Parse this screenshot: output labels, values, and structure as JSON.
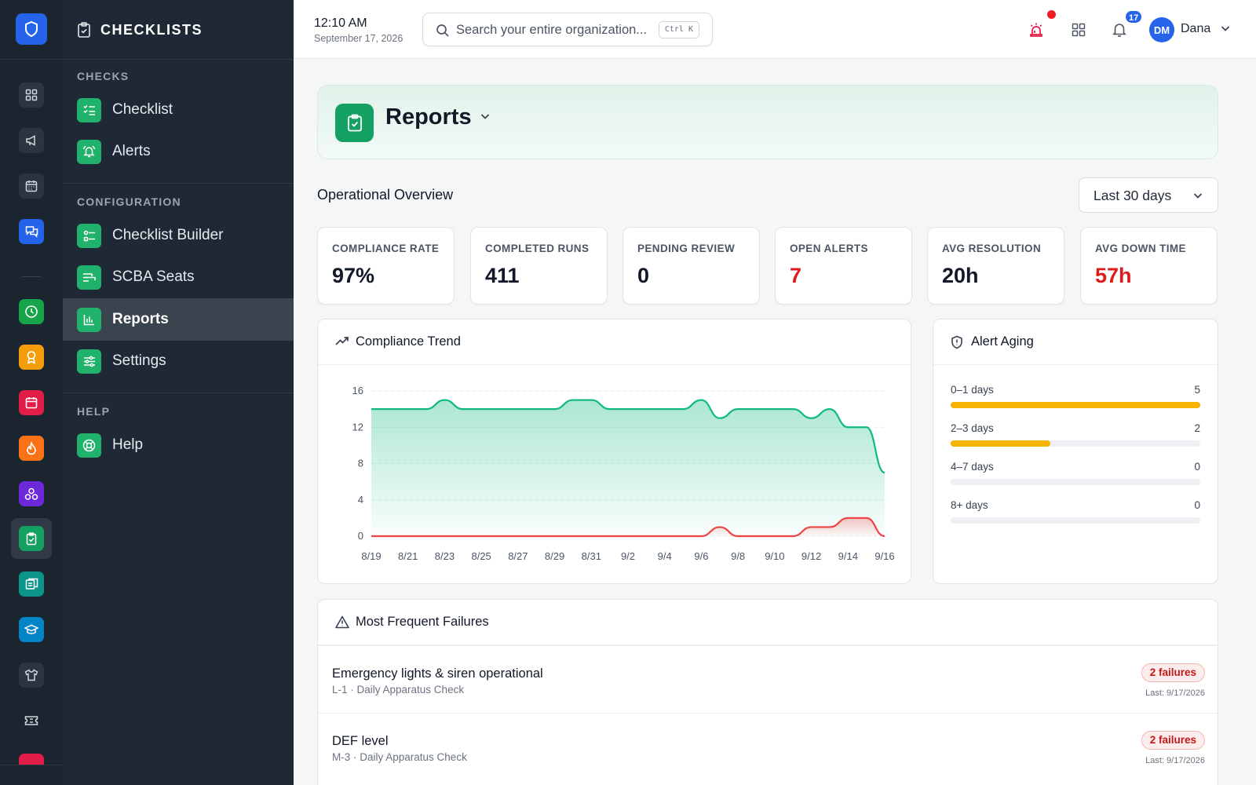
{
  "app": {
    "section_title": "CHECKLISTS"
  },
  "sidebar": {
    "sections": [
      {
        "label": "CHECKS",
        "items": [
          {
            "label": "Checklist",
            "icon": "list-check-icon"
          },
          {
            "label": "Alerts",
            "icon": "bell-ring-icon"
          }
        ]
      },
      {
        "label": "CONFIGURATION",
        "items": [
          {
            "label": "Checklist Builder",
            "icon": "builder-icon"
          },
          {
            "label": "SCBA Seats",
            "icon": "seats-icon"
          },
          {
            "label": "Reports",
            "icon": "bar-chart-icon",
            "active": true
          },
          {
            "label": "Settings",
            "icon": "sliders-icon"
          }
        ]
      },
      {
        "label": "HELP",
        "items": [
          {
            "label": "Help",
            "icon": "lifebuoy-icon"
          }
        ]
      }
    ]
  },
  "rail": {
    "colors": {
      "logo": "#2563eb",
      "clock": "#16a34a",
      "award": "#f59e0b",
      "calendar": "#e11d48",
      "fire": "#f97316",
      "network": "#6d28d9",
      "checklist": "#14a063",
      "docs": "#0d9488",
      "training": "#0284c7"
    }
  },
  "topbar": {
    "time": "12:10 AM",
    "date": "September 17, 2026",
    "search_placeholder": "Search your entire organization...",
    "search_shortcut": "Ctrl K",
    "notification_count": "17",
    "user_initials": "DM",
    "user_name": "Dana"
  },
  "page": {
    "title": "Reports",
    "overview_title": "Operational Overview",
    "range_label": "Last 30 days",
    "accent": "#14a063"
  },
  "stats": [
    {
      "label": "COMPLIANCE RATE",
      "value": "97%",
      "alert": false
    },
    {
      "label": "COMPLETED RUNS",
      "value": "411",
      "alert": false
    },
    {
      "label": "PENDING REVIEW",
      "value": "0",
      "alert": false
    },
    {
      "label": "OPEN ALERTS",
      "value": "7",
      "alert": true
    },
    {
      "label": "AVG RESOLUTION",
      "value": "20h",
      "alert": false
    },
    {
      "label": "AVG DOWN TIME",
      "value": "57h",
      "alert": true
    }
  ],
  "trend_card": {
    "title": "Compliance Trend"
  },
  "chart_data": {
    "type": "area",
    "title": "Compliance Trend",
    "xlabel": "",
    "ylabel": "",
    "ylim": [
      0,
      16
    ],
    "yticks": [
      0,
      4,
      8,
      12,
      16
    ],
    "grid": true,
    "x": [
      "8/19",
      "8/20",
      "8/21",
      "8/22",
      "8/23",
      "8/24",
      "8/25",
      "8/26",
      "8/27",
      "8/28",
      "8/29",
      "8/30",
      "8/31",
      "9/1",
      "9/2",
      "9/3",
      "9/4",
      "9/5",
      "9/6",
      "9/7",
      "9/8",
      "9/9",
      "9/10",
      "9/11",
      "9/12",
      "9/13",
      "9/14",
      "9/15",
      "9/16"
    ],
    "xtick_labels": [
      "8/19",
      "8/21",
      "8/23",
      "8/25",
      "8/27",
      "8/29",
      "8/31",
      "9/2",
      "9/4",
      "9/6",
      "9/8",
      "9/10",
      "9/12",
      "9/14",
      "9/16"
    ],
    "series": [
      {
        "values": [
          14,
          14,
          14,
          14,
          15,
          14,
          14,
          14,
          14,
          14,
          14,
          15,
          15,
          14,
          14,
          14,
          14,
          14,
          15,
          13,
          14,
          14,
          14,
          14,
          13,
          14,
          12,
          12,
          7
        ],
        "color": "#10b981"
      },
      {
        "values": [
          0,
          0,
          0,
          0,
          0,
          0,
          0,
          0,
          0,
          0,
          0,
          0,
          0,
          0,
          0,
          0,
          0,
          0,
          0,
          1,
          0,
          0,
          0,
          0,
          1,
          1,
          2,
          2,
          0
        ],
        "color": "#ef4444"
      }
    ]
  },
  "aging_card": {
    "title": "Alert Aging",
    "max": 5,
    "rows": [
      {
        "label": "0–1 days",
        "value": 5,
        "display": "5"
      },
      {
        "label": "2–3 days",
        "value": 2,
        "display": "2"
      },
      {
        "label": "4–7 days",
        "value": 0,
        "display": "0"
      },
      {
        "label": "8+ days",
        "value": 0,
        "display": "0"
      }
    ]
  },
  "failures_card": {
    "title": "Most Frequent Failures",
    "rows": [
      {
        "title": "Emergency lights & siren operational",
        "subtitle": "L-1 · Daily Apparatus Check",
        "badge": "2 failures",
        "last": "Last: 9/17/2026"
      },
      {
        "title": "DEF level",
        "subtitle": "M-3 · Daily Apparatus Check",
        "badge": "2 failures",
        "last": "Last: 9/17/2026"
      }
    ]
  }
}
